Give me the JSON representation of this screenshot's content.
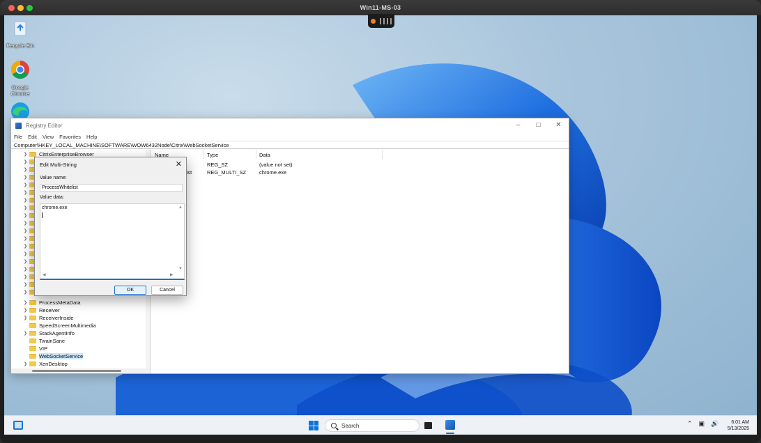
{
  "host": {
    "title": "Win11-MS-03"
  },
  "desktop_icons": [
    {
      "label": "Recycle Bin",
      "icon": "recycle-bin-icon"
    },
    {
      "label": "Google Chrome",
      "icon": "chrome-icon"
    },
    {
      "label": "",
      "icon": "edge-icon"
    }
  ],
  "regedit": {
    "title": "Registry Editor",
    "menu": [
      "File",
      "Edit",
      "View",
      "Favorites",
      "Help"
    ],
    "address": "Computer\\HKEY_LOCAL_MACHINE\\SOFTWARE\\WOW6432Node\\Citrix\\WebSocketService",
    "tree": [
      {
        "label": "CitrixEnterpriseBrowser",
        "expand": true
      },
      {
        "label": "ProcessMetaData",
        "expand": true
      },
      {
        "label": "Receiver",
        "expand": true
      },
      {
        "label": "ReceiverInside",
        "expand": true
      },
      {
        "label": "SpeedScreenMultimedia",
        "expand": false
      },
      {
        "label": "StackAgentInfo",
        "expand": true
      },
      {
        "label": "TwainSane",
        "expand": false
      },
      {
        "label": "VIP",
        "expand": false
      },
      {
        "label": "WebSocketService",
        "expand": false,
        "selected": true
      },
      {
        "label": "XenDesktop",
        "expand": true
      }
    ],
    "columns": {
      "name": "Name",
      "type": "Type",
      "data": "Data"
    },
    "rows": [
      {
        "name": "",
        "type": "REG_SZ",
        "data": "(value not set)"
      },
      {
        "name": "hitelist",
        "type": "REG_MULTI_SZ",
        "data": "chrome.exe"
      }
    ]
  },
  "dialog": {
    "title": "Edit Multi-String",
    "value_name_label": "Value name:",
    "value_name": "ProcessWhitelist",
    "value_data_label": "Value data:",
    "value_data": "chrome.exe",
    "ok": "OK",
    "cancel": "Cancel"
  },
  "taskbar": {
    "search_label": "Search",
    "time": "6:01 AM",
    "date": "5/13/2025",
    "accent": "#1a6fd1"
  }
}
